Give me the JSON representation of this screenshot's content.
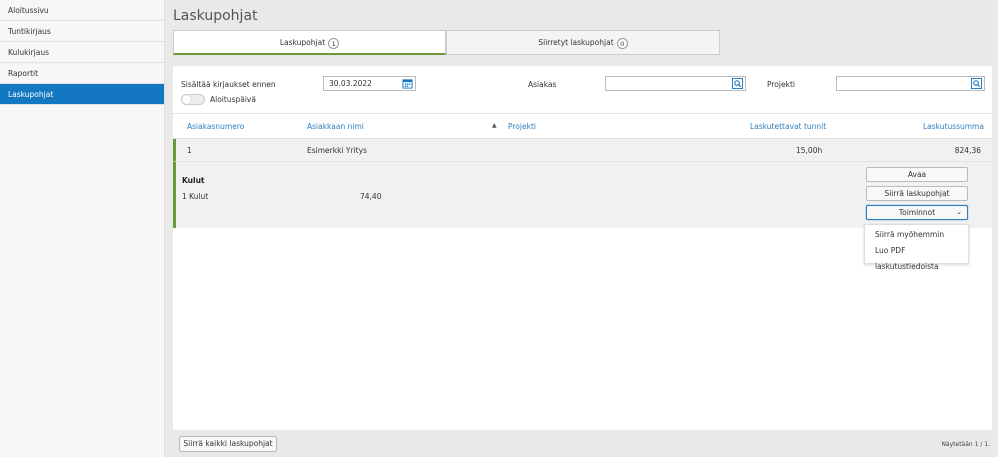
{
  "sidebar": {
    "items": [
      {
        "label": "Aloitussivu"
      },
      {
        "label": "Tuntikirjaus"
      },
      {
        "label": "Kulukirjaus"
      },
      {
        "label": "Raportit"
      },
      {
        "label": "Laskupohjat"
      }
    ],
    "active_index": 4
  },
  "page": {
    "title": "Laskupohjat"
  },
  "tabs": [
    {
      "label": "Laskupohjat",
      "count": "1"
    },
    {
      "label": "Siirretyt laskupohjat",
      "count": "0"
    }
  ],
  "filters": {
    "date_label": "Sisältää kirjaukset ennen",
    "date_value": "30.03.2022",
    "toggle_label": "Aloituspäivä",
    "customer_label": "Asiakas",
    "customer_value": "",
    "project_label": "Projekti",
    "project_value": ""
  },
  "table": {
    "headers": [
      "Asiakasnumero",
      "Asiakkaan nimi",
      "Projekti",
      "Laskutettavat tunnit",
      "Laskutussumma"
    ],
    "rows": [
      {
        "number": "1",
        "name": "Esimerkki Yritys",
        "project": "",
        "hours": "15,00h",
        "sum": "824,36"
      }
    ]
  },
  "detail": {
    "title": "Kulut",
    "expense_label": "1 Kulut",
    "expense_value": "74,40"
  },
  "actions": {
    "open": "Avaa",
    "transfer": "Siirrä laskupohjat",
    "menu_toggle": "Toiminnot",
    "menu_items": [
      "Siirrä myöhemmin",
      "Luo PDF laskutustiedoista"
    ]
  },
  "footer": {
    "transfer_all": "Siirrä kaikki laskupohjat",
    "paging": "Näytetään 1 / 1."
  },
  "colors": {
    "accent": "#1477c2",
    "link": "#2d7fc1",
    "row_marker": "#6b9a3a"
  }
}
